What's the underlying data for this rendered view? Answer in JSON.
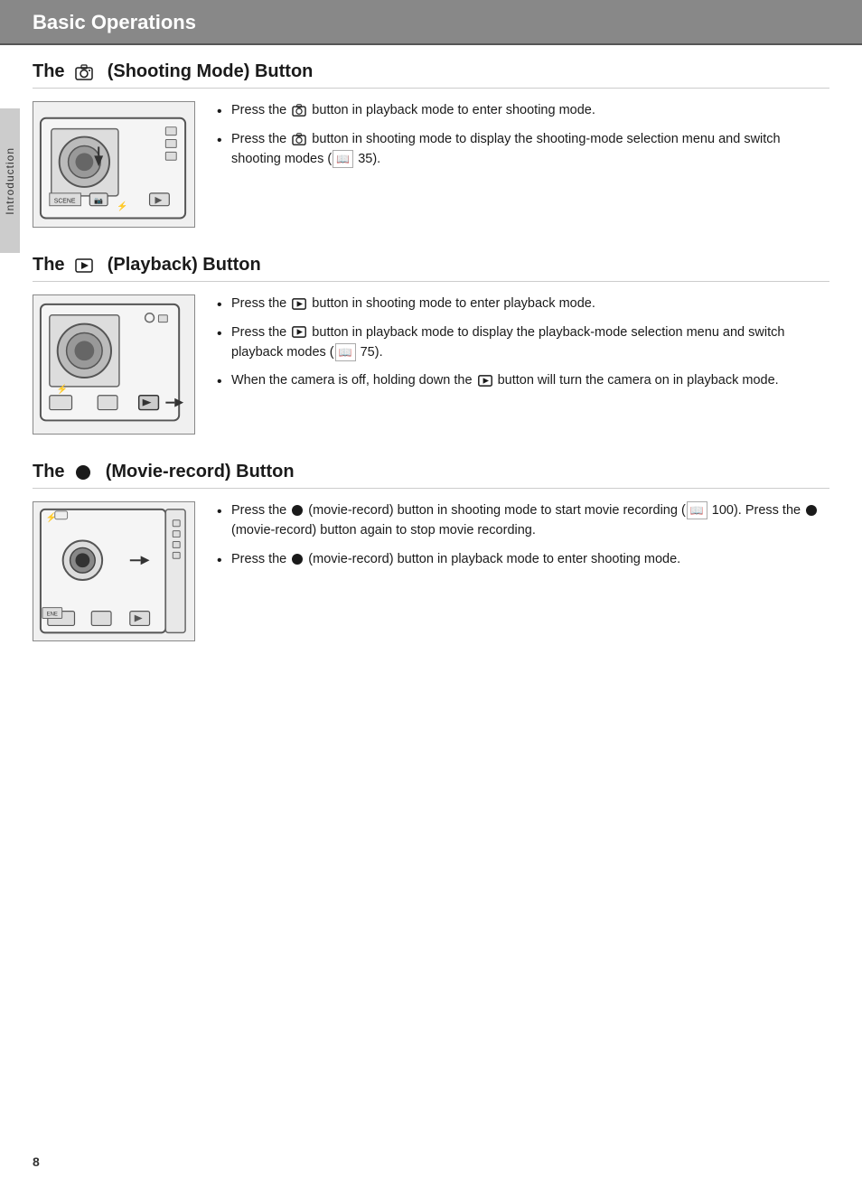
{
  "header": {
    "title": "Basic Operations"
  },
  "side_tab": {
    "label": "Introduction"
  },
  "sections": [
    {
      "id": "shooting-mode",
      "title_prefix": "The",
      "title_icon": "camera-icon",
      "title_suffix": "(Shooting Mode) Button",
      "bullets": [
        "Press the [camera] button in playback mode to enter shooting mode.",
        "Press the [camera] button in shooting mode to display the shooting-mode selection menu and switch shooting modes ([book] 35)."
      ]
    },
    {
      "id": "playback",
      "title_prefix": "The",
      "title_icon": "play-icon",
      "title_suffix": "(Playback) Button",
      "bullets": [
        "Press the [play] button in shooting mode to enter playback mode.",
        "Press the [play] button in playback mode to display the playback-mode selection menu and switch playback modes ([book] 75).",
        "When the camera is off, holding down the [play] button will turn the camera on in playback mode."
      ]
    },
    {
      "id": "movie-record",
      "title_prefix": "The",
      "title_icon": "circle-icon",
      "title_suffix": "(Movie-record) Button",
      "bullets": [
        "Press the [circle] (movie-record) button in shooting mode to start movie recording ([book] 100). Press the [circle] (movie-record) button again to stop movie recording.",
        "Press the [circle] (movie-record) button in playback mode to enter shooting mode."
      ]
    }
  ],
  "page_number": "8"
}
